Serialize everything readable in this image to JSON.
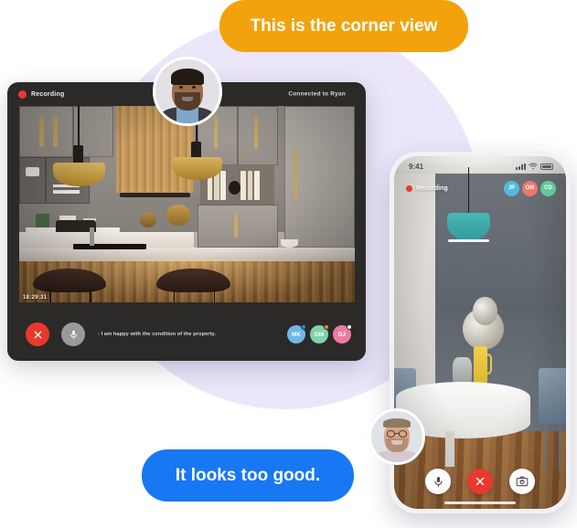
{
  "callouts": {
    "top": "This is the corner view",
    "bottom": "It looks too good."
  },
  "colors": {
    "callout_top_bg": "#f2a20c",
    "callout_bottom_bg": "#1877f2",
    "background_blob": "#ebe6fa",
    "recording_red": "#e8392c",
    "window_bg": "#2b2a28"
  },
  "desktop_window": {
    "recording_label": "Recording",
    "connected_label": "Connected to Ryan",
    "timestamp": "18:29:31",
    "caption": "- I am happy with the condition of the property.",
    "end_call_icon": "close-icon",
    "mic_icon": "microphone-icon",
    "participants": [
      {
        "initials": "MK",
        "color": "#6fb7e8",
        "status_color": "#1a8fe0"
      },
      {
        "initials": "OM",
        "color": "#7fd3a8",
        "status_color": "#f08a1e"
      },
      {
        "initials": "DJ",
        "color": "#ef7aa0",
        "status_color": "#f2f2f2"
      }
    ],
    "video_scene": "modern-kitchen"
  },
  "phone": {
    "status_time": "9:41",
    "signal_icon": "cellular-signal-icon",
    "wifi_icon": "wifi-icon",
    "battery_icon": "battery-icon",
    "recording_label": "Recording",
    "participants": [
      {
        "initials": "JP",
        "color": "#56b9e0"
      },
      {
        "initials": "OM",
        "color": "#f0776a"
      },
      {
        "initials": "CD",
        "color": "#63c99a"
      }
    ],
    "controls": [
      {
        "name": "microphone-button",
        "icon": "microphone-icon"
      },
      {
        "name": "end-call-button",
        "icon": "close-icon"
      },
      {
        "name": "flip-camera-button",
        "icon": "camera-flip-icon"
      }
    ],
    "video_scene": "dining-room"
  }
}
